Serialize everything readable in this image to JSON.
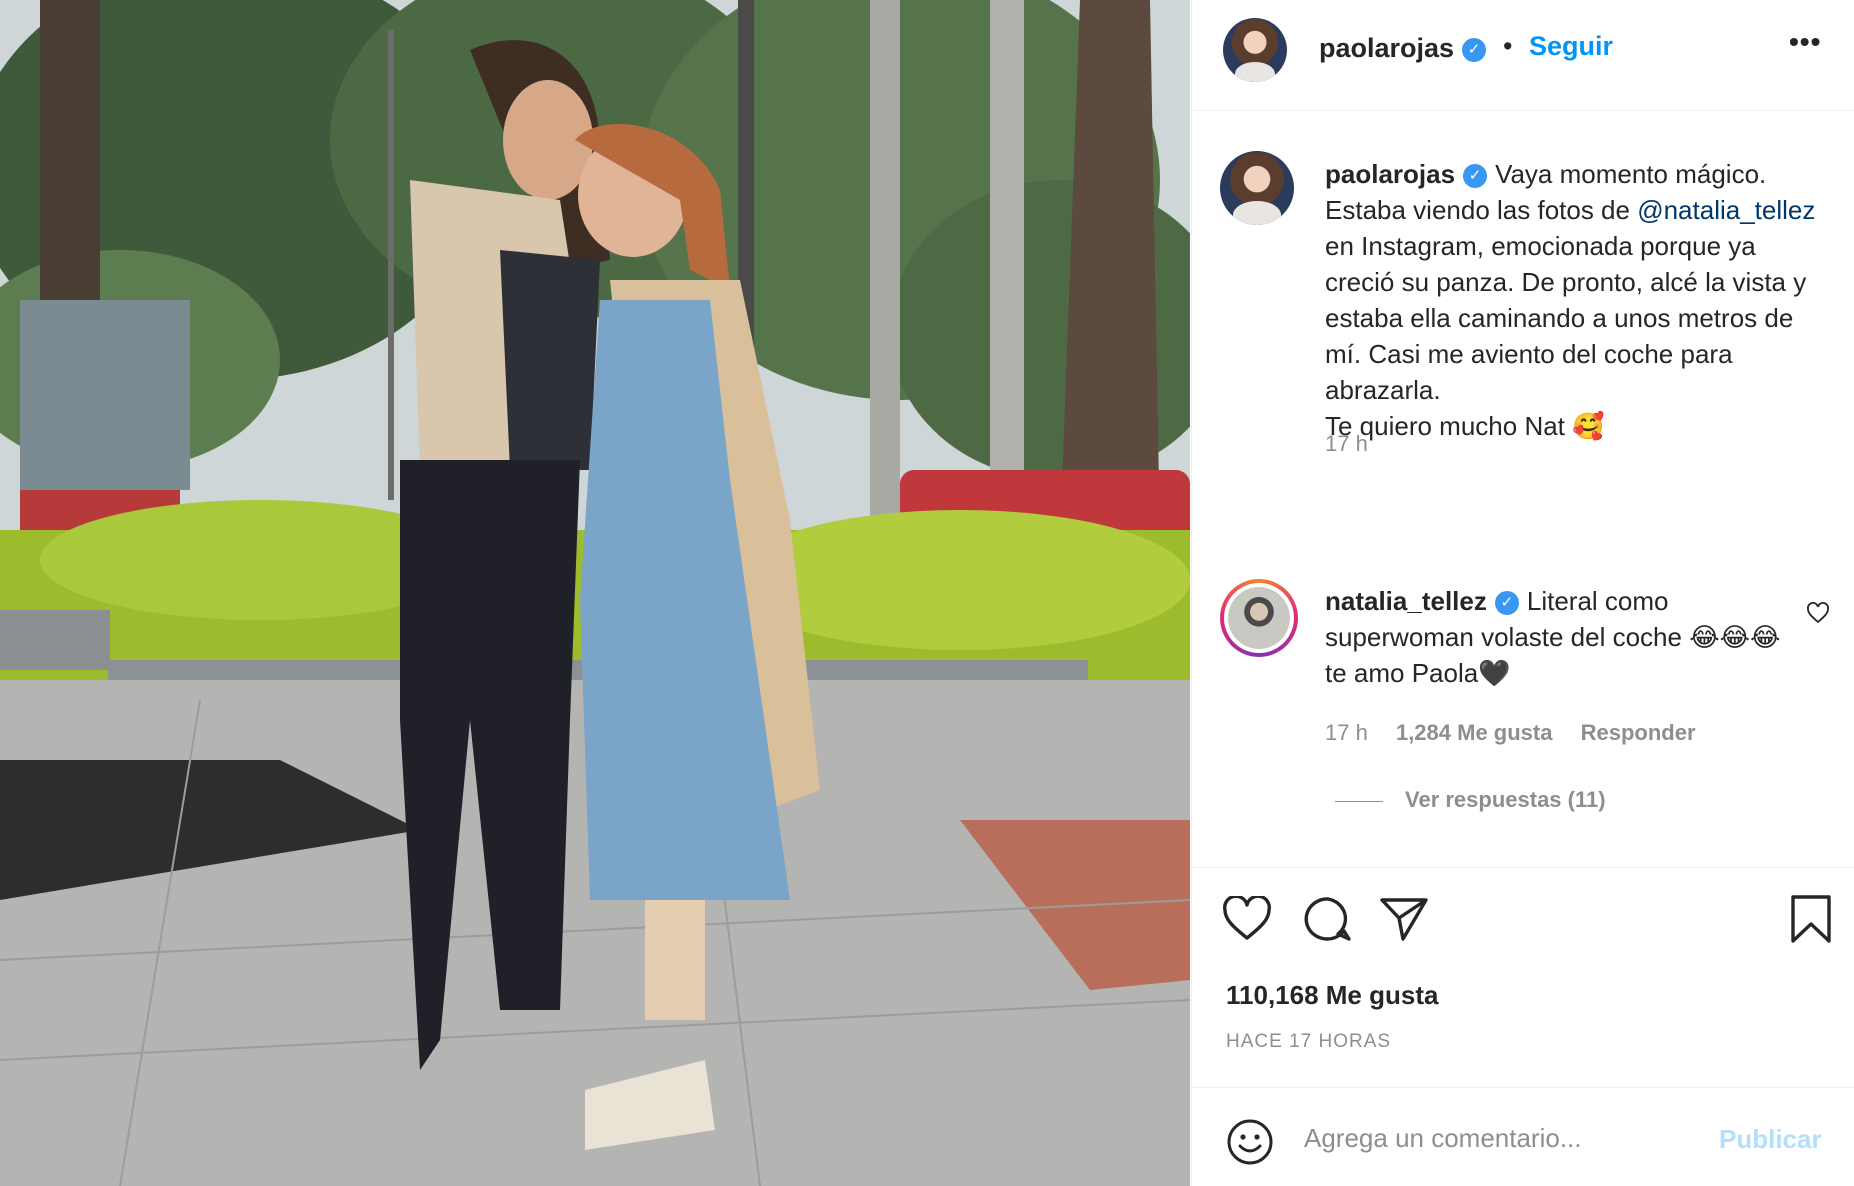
{
  "header": {
    "username": "paolarojas",
    "verified_glyph": "✓",
    "separator": "•",
    "follow_label": "Seguir",
    "more_label": "•••"
  },
  "caption": {
    "username": "paolarojas",
    "text_before_mention": "Vaya momento mágico. Estaba viendo las fotos de ",
    "mention": "@natalia_tellez",
    "text_after_mention": " en Instagram, emocionada porque ya creció su panza. De pronto, alcé la vista y estaba ella caminando a unos metros de mí. Casi me aviento del coche para abrazarla.",
    "last_line": "Te quiero mucho Nat 🥰",
    "time": "17 h"
  },
  "comment": {
    "username": "natalia_tellez",
    "text": "Literal como superwoman volaste del coche 😂😂😂 te amo Paola🖤",
    "time": "17 h",
    "likes": "1,284 Me gusta",
    "reply_label": "Responder",
    "view_replies": "Ver respuestas (11)"
  },
  "post": {
    "likes": "110,168 Me gusta",
    "ago": "HACE 17 HORAS"
  },
  "composer": {
    "placeholder": "Agrega un comentario...",
    "publish_label": "Publicar"
  },
  "icons": {
    "verified": "verified-badge-icon",
    "more": "more-options-icon",
    "like": "heart-icon",
    "comment": "comment-bubble-icon",
    "share": "paper-plane-icon",
    "save": "bookmark-icon",
    "emoji": "smiley-icon"
  },
  "colors": {
    "link_blue": "#0095f6",
    "verified_blue": "#3897f0",
    "mention_blue": "#00376b",
    "muted_gray": "#8e8e8e",
    "publish_disabled": "#b2dffc"
  }
}
